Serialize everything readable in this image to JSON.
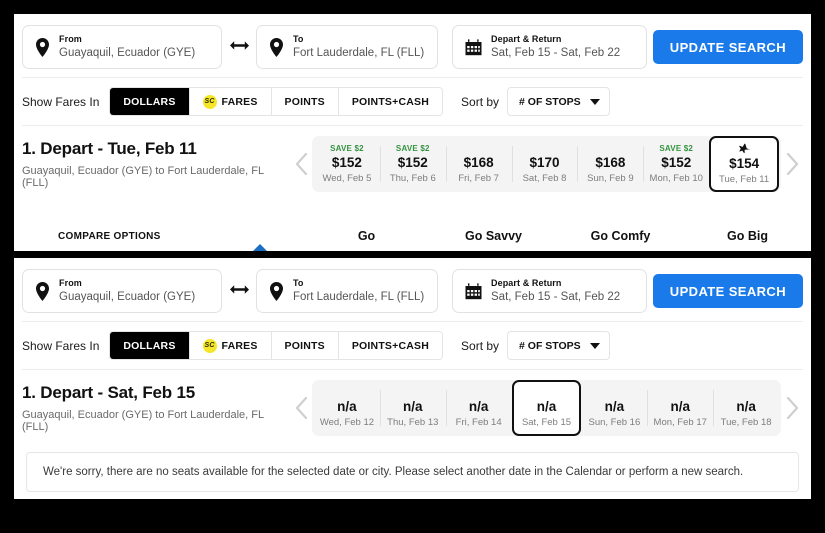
{
  "panels": [
    {
      "search": {
        "from": {
          "label": "From",
          "value": "Guayaquil, Ecuador (GYE)",
          "icon": "location-pin-icon"
        },
        "swap_icon": "swap-arrows-icon",
        "to": {
          "label": "To",
          "value": "Fort Lauderdale, FL (FLL)",
          "icon": "location-pin-icon"
        },
        "dates": {
          "label": "Depart & Return",
          "value": "Sat, Feb 15 - Sat, Feb 22",
          "icon": "calendar-icon"
        },
        "update_button": "UPDATE SEARCH"
      },
      "filters": {
        "show_fares_label": "Show Fares In",
        "options": [
          {
            "label": "DOLLARS",
            "active": true,
            "badge": null
          },
          {
            "label": "FARES",
            "active": false,
            "badge": "SC"
          },
          {
            "label": "POINTS",
            "active": false,
            "badge": null
          },
          {
            "label": "POINTS+CASH",
            "active": false,
            "badge": null
          }
        ],
        "sort_label": "Sort by",
        "sort_value": "# OF STOPS"
      },
      "depart": {
        "title": "1. Depart - Tue, Feb 11",
        "subtitle": "Guayaquil, Ecuador (GYE) to Fort Lauderdale, FL (FLL)",
        "prev_icon": "chevron-left-icon",
        "next_icon": "chevron-right-icon",
        "fares": [
          {
            "save": "SAVE $2",
            "price": "$152",
            "date": "Wed, Feb 5",
            "selected": false,
            "plane": false
          },
          {
            "save": "SAVE $2",
            "price": "$152",
            "date": "Thu, Feb 6",
            "selected": false,
            "plane": false
          },
          {
            "save": "",
            "price": "$168",
            "date": "Fri, Feb 7",
            "selected": false,
            "plane": false
          },
          {
            "save": "",
            "price": "$170",
            "date": "Sat, Feb 8",
            "selected": false,
            "plane": false
          },
          {
            "save": "",
            "price": "$168",
            "date": "Sun, Feb 9",
            "selected": false,
            "plane": false
          },
          {
            "save": "SAVE $2",
            "price": "$152",
            "date": "Mon, Feb 10",
            "selected": false,
            "plane": false
          },
          {
            "save": "",
            "price": "$154",
            "date": "Tue, Feb 11",
            "selected": true,
            "plane": true
          }
        ]
      },
      "compare": {
        "label": "COMPARE OPTIONS",
        "columns": [
          "Go",
          "Go Savvy",
          "Go Comfy",
          "Go Big"
        ]
      }
    },
    {
      "search": {
        "from": {
          "label": "From",
          "value": "Guayaquil, Ecuador (GYE)",
          "icon": "location-pin-icon"
        },
        "swap_icon": "swap-arrows-icon",
        "to": {
          "label": "To",
          "value": "Fort Lauderdale, FL (FLL)",
          "icon": "location-pin-icon"
        },
        "dates": {
          "label": "Depart & Return",
          "value": "Sat, Feb 15 - Sat, Feb 22",
          "icon": "calendar-icon"
        },
        "update_button": "UPDATE SEARCH"
      },
      "filters": {
        "show_fares_label": "Show Fares In",
        "options": [
          {
            "label": "DOLLARS",
            "active": true,
            "badge": null
          },
          {
            "label": "FARES",
            "active": false,
            "badge": "SC"
          },
          {
            "label": "POINTS",
            "active": false,
            "badge": null
          },
          {
            "label": "POINTS+CASH",
            "active": false,
            "badge": null
          }
        ],
        "sort_label": "Sort by",
        "sort_value": "# OF STOPS"
      },
      "depart": {
        "title": "1. Depart - Sat, Feb 15",
        "subtitle": "Guayaquil, Ecuador (GYE) to Fort Lauderdale, FL (FLL)",
        "prev_icon": "chevron-left-icon",
        "next_icon": "chevron-right-icon",
        "fares": [
          {
            "save": "",
            "price": "n/a",
            "date": "Wed, Feb 12",
            "selected": false,
            "plane": false
          },
          {
            "save": "",
            "price": "n/a",
            "date": "Thu, Feb 13",
            "selected": false,
            "plane": false
          },
          {
            "save": "",
            "price": "n/a",
            "date": "Fri, Feb 14",
            "selected": false,
            "plane": false
          },
          {
            "save": "",
            "price": "n/a",
            "date": "Sat, Feb 15",
            "selected": true,
            "plane": false
          },
          {
            "save": "",
            "price": "n/a",
            "date": "Sun, Feb 16",
            "selected": false,
            "plane": false
          },
          {
            "save": "",
            "price": "n/a",
            "date": "Mon, Feb 17",
            "selected": false,
            "plane": false
          },
          {
            "save": "",
            "price": "n/a",
            "date": "Tue, Feb 18",
            "selected": false,
            "plane": false
          }
        ]
      },
      "notice": "We're sorry, there are no seats available for the selected date or city. Please select another date in the Calendar or perform a new search."
    }
  ],
  "colors": {
    "accent_blue": "#1a7aea",
    "save_green": "#33933f",
    "badge_yellow": "#f5e62a",
    "active_black": "#000000"
  }
}
